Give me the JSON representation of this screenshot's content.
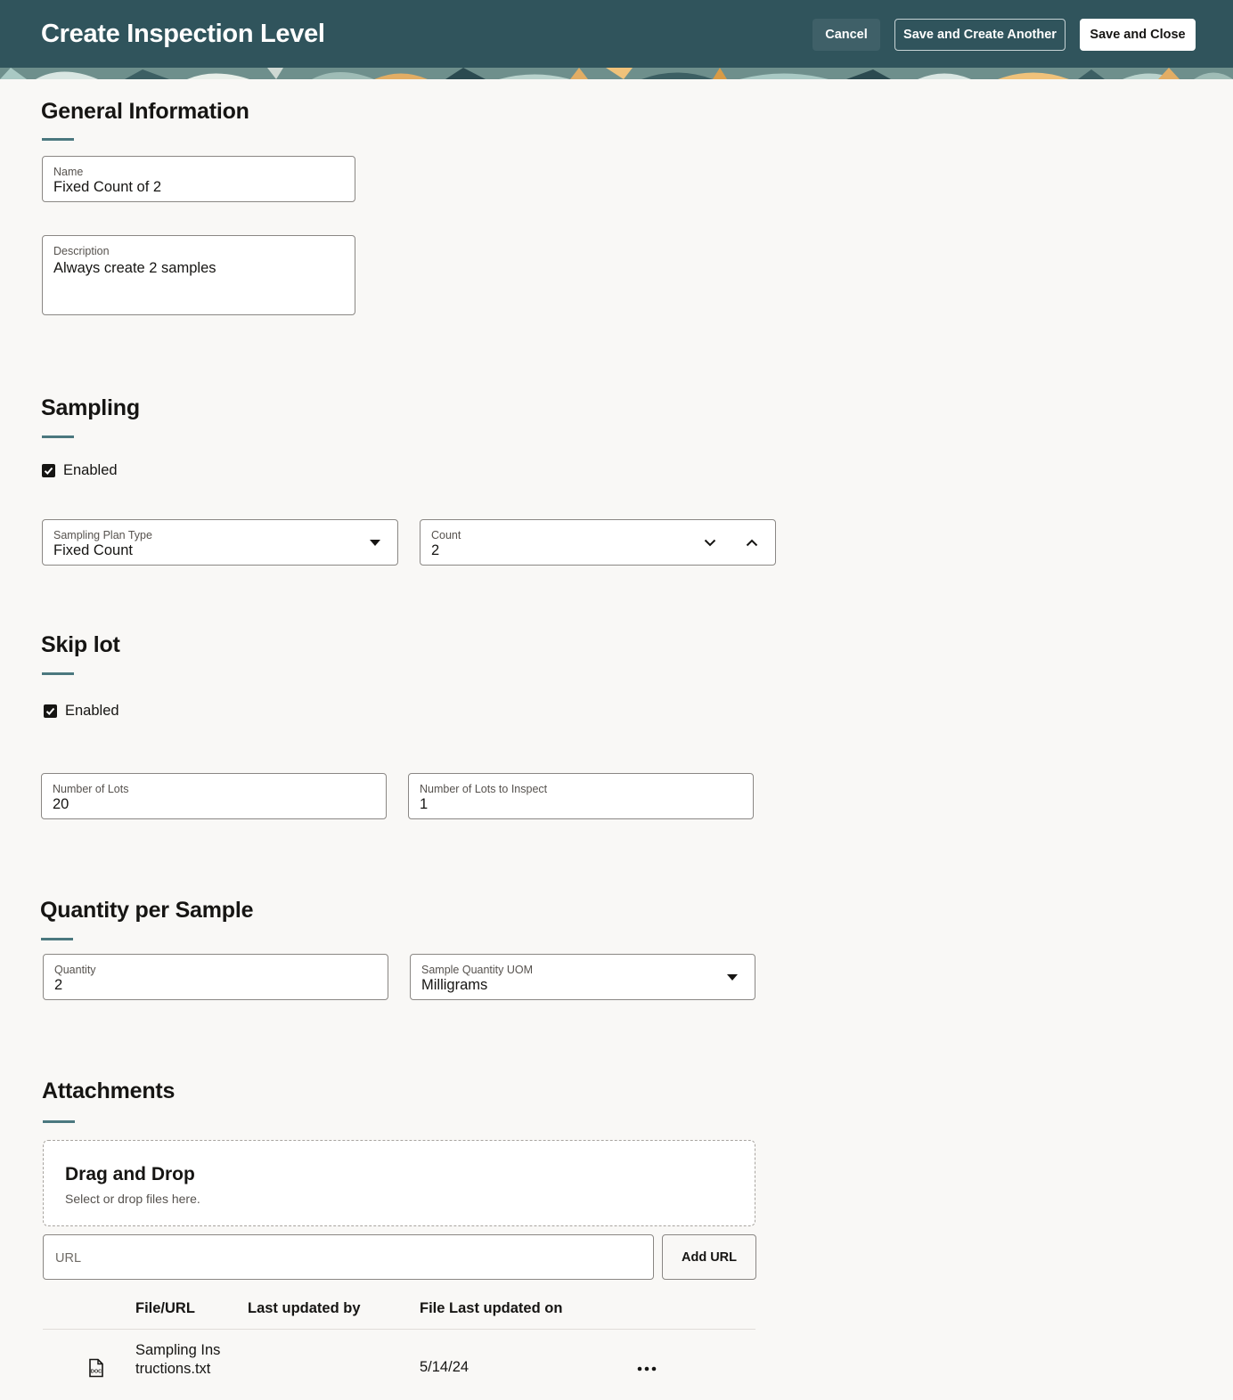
{
  "header": {
    "title": "Create Inspection Level",
    "cancel_label": "Cancel",
    "save_another_label": "Save and Create Another",
    "save_close_label": "Save and Close",
    "background_color": "#30545c"
  },
  "general": {
    "title": "General Information",
    "name_label": "Name",
    "name_value": "Fixed Count of 2",
    "description_label": "Description",
    "description_value": "Always create 2 samples"
  },
  "sampling": {
    "title": "Sampling",
    "enabled_label": "Enabled",
    "enabled": true,
    "plan_type_label": "Sampling Plan Type",
    "plan_type_value": "Fixed Count",
    "count_label": "Count",
    "count_value": "2"
  },
  "skip_lot": {
    "title": "Skip lot",
    "enabled_label": "Enabled",
    "enabled": true,
    "num_lots_label": "Number of Lots",
    "num_lots_value": "20",
    "lots_inspect_label": "Number of Lots to Inspect",
    "lots_inspect_value": "1"
  },
  "quantity": {
    "title": "Quantity per Sample",
    "quantity_label": "Quantity",
    "quantity_value": "2",
    "uom_label": "Sample Quantity UOM",
    "uom_value": "Milligrams"
  },
  "attachments": {
    "title": "Attachments",
    "dropzone_title": "Drag and Drop",
    "dropzone_subtitle": "Select or drop files here.",
    "url_placeholder": "URL",
    "add_url_label": "Add URL",
    "columns": [
      "File/URL",
      "Last updated by",
      "File Last updated on"
    ],
    "rows": [
      {
        "icon": "doc-file-icon",
        "file": "Sampling Instructions.txt",
        "updated_by": "",
        "updated_on": "5/14/24"
      }
    ]
  },
  "accent_color": "#4b787f"
}
